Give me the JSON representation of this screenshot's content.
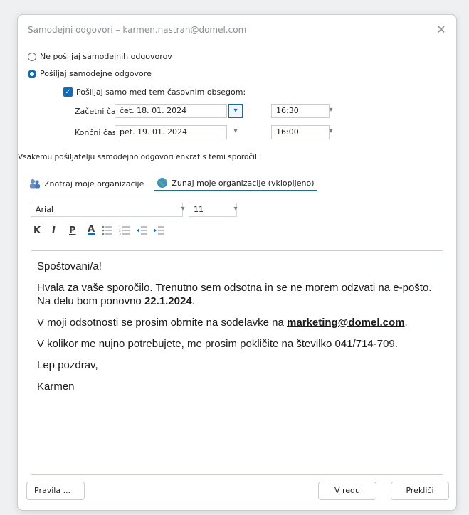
{
  "dialog": {
    "title": "Samodejni odgovori – karmen.nastran@domel.com",
    "close_glyph": "✕"
  },
  "options": {
    "no_reply_label": "Ne pošiljaj samodejnih odgovorov",
    "send_reply_label": "Pošiljaj samodejne odgovore",
    "selected": "send",
    "time_range_label": "Pošiljaj samo med tem časovnim obsegom:",
    "time_range_checked": true
  },
  "times": {
    "start_label": "Začetni čas:",
    "start_date": "čet. 18. 01. 2024",
    "start_time": "16:30",
    "end_label": "Končni čas:",
    "end_date": "pet. 19. 01. 2024",
    "end_time": "16:00"
  },
  "instruction": "Vsakemu pošiljatelju samodejno odgovori enkrat s temi sporočili:",
  "tabs": [
    {
      "label": "Znotraj moje organizacije",
      "icon": "people-icon"
    },
    {
      "label": "Zunaj moje organizacije (vklopljeno)",
      "icon": "globe-icon"
    }
  ],
  "format": {
    "font": "Arial",
    "size": "11",
    "bold": "K",
    "italic": "I",
    "underline": "P",
    "font_color": "A"
  },
  "message": {
    "greeting": "Spoštovani/a!",
    "p1_text": "Hvala za vaše sporočilo. Trenutno sem odsotna in se ne morem odzvati na e-pošto. Na delu bom ponovno ",
    "p1_date": "22.1.2024",
    "p1_end": ".",
    "p2_text": "V moji odsotnosti se prosim obrnite na sodelavke na ",
    "p2_email": "marketing@domel.com",
    "p2_end": ".",
    "p3_text": "V kolikor me nujno potrebujete, me prosim pokličite na številko 041/714-709.",
    "closing": "Lep pozdrav,",
    "signature": "Karmen"
  },
  "buttons": {
    "rules": "Pravila ...",
    "ok": "V redu",
    "cancel": "Prekliči"
  },
  "colors": {
    "accent": "#0f6cbd"
  }
}
